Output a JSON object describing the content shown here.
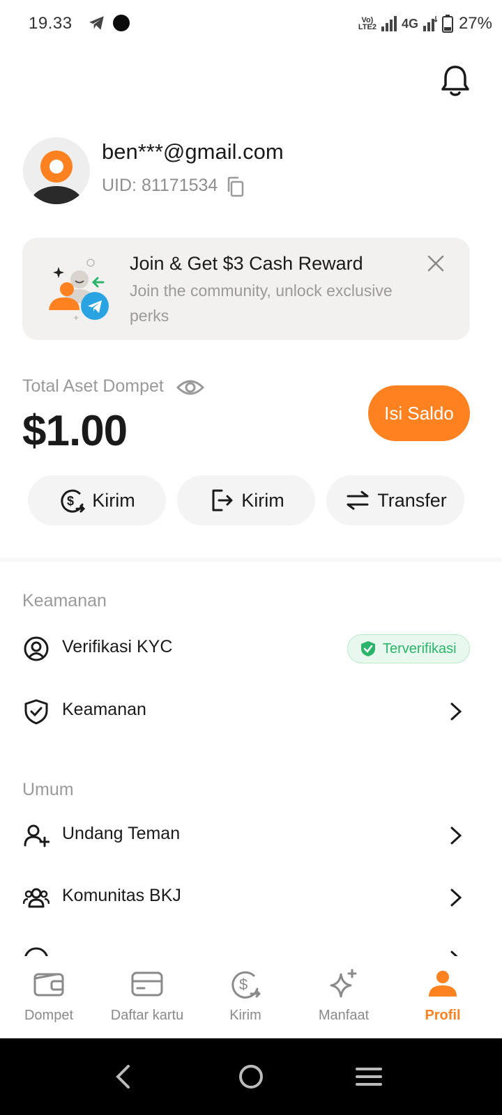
{
  "status_bar": {
    "time": "19.33",
    "network_type": "4G",
    "volte_top": "Vo)",
    "volte_bottom": "LTE2",
    "battery": "27%"
  },
  "profile": {
    "email": "ben***@gmail.com",
    "uid": "UID: 81171534"
  },
  "banner": {
    "title": "Join & Get $3 Cash Reward",
    "subtitle": "Join the community, unlock exclusive perks"
  },
  "balance": {
    "label": "Total Aset Dompet",
    "value": "$1.00",
    "topup_label": "Isi Saldo"
  },
  "actions": [
    {
      "label": "Kirim",
      "icon": "dollar-send-icon"
    },
    {
      "label": "Kirim",
      "icon": "exit-arrow-icon"
    },
    {
      "label": "Transfer",
      "icon": "swap-arrows-icon"
    }
  ],
  "security_section": {
    "title": "Keamanan",
    "items": [
      {
        "label": "Verifikasi KYC",
        "icon": "user-circle-icon",
        "badge": "Terverifikasi"
      },
      {
        "label": "Keamanan",
        "icon": "shield-check-icon"
      }
    ]
  },
  "general_section": {
    "title": "Umum",
    "items": [
      {
        "label": "Undang Teman",
        "icon": "user-plus-icon"
      },
      {
        "label": "Komunitas BKJ",
        "icon": "users-group-icon"
      }
    ]
  },
  "bottom_nav": {
    "items": [
      {
        "label": "Dompet",
        "icon": "wallet-icon",
        "active": false
      },
      {
        "label": "Daftar kartu",
        "icon": "card-icon",
        "active": false
      },
      {
        "label": "Kirim",
        "icon": "dollar-send-icon",
        "active": false
      },
      {
        "label": "Manfaat",
        "icon": "sparkle-icon",
        "active": false
      },
      {
        "label": "Profil",
        "icon": "profile-icon",
        "active": true
      }
    ]
  },
  "colors": {
    "accent": "#ff8120",
    "verified": "#2bb56a",
    "muted_text": "#9a9a9a",
    "banner_bg": "#f2f1ef"
  }
}
